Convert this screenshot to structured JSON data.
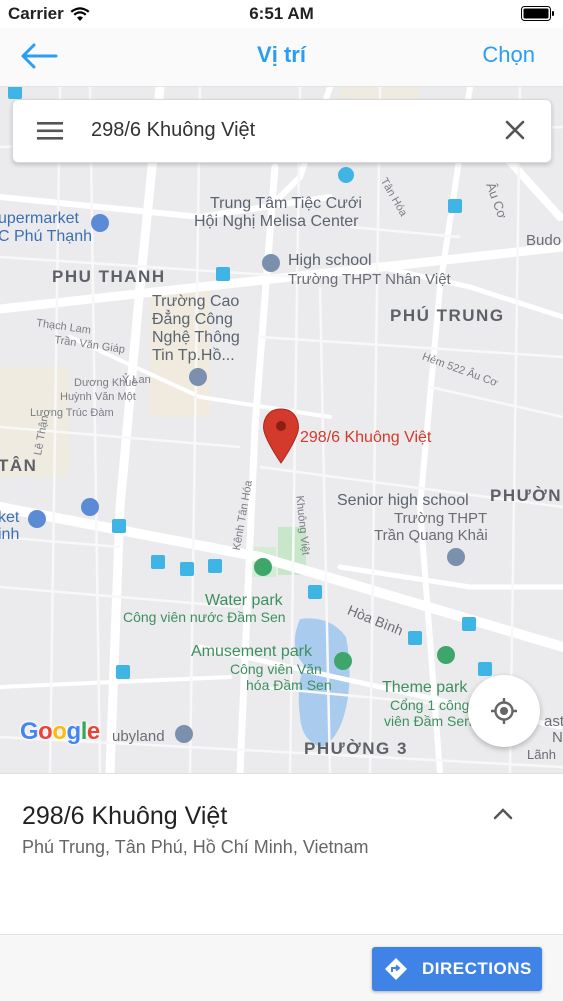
{
  "status_bar": {
    "carrier": "Carrier",
    "time": "6:51 AM"
  },
  "nav": {
    "title": "Vị trí",
    "action": "Chọn"
  },
  "search": {
    "query": "298/6 Khuông Việt"
  },
  "map": {
    "labels": {
      "supermarket": "upermarket",
      "phu_thanh_edge": "C Phú Thạnh",
      "melisa_1": "Trung Tâm Tiệc Cưới",
      "melisa_2": "Hội Nghị Melisa Center",
      "tan_hoa_street": "Tân Hóa",
      "au_co_street": "Âu Cơ",
      "budo": "Budo",
      "phu_thanh": "PHU THANH",
      "high_school": "High school",
      "nhan_viet": "Trường THPT Nhân Việt",
      "cao_dang_1": "Trường Cao",
      "cao_dang_2": "Đẳng Công",
      "cao_dang_3": "Nghệ Thông",
      "cao_dang_4": "Tin Tp.Hồ...",
      "phu_trung": "PHÚ TRUNG",
      "thach_lam": "Thạch Lam",
      "tran_van_giap": "Trần Văn Giáp",
      "y_lan": "Ỷ Lan",
      "duong_khue": "Dương Khuê",
      "huynh_van_mot": "Huỳnh Văn Một",
      "luong_truc_dam": "Lương Trúc Đàm",
      "hem_522": "Hẻm 522 Âu Cơ",
      "pin_label": "298/6 Khuông Việt",
      "le_than": "Lê Thận",
      "tan_edge": "TÂN",
      "kenh_tan_hoa": "Kênh Tân Hóa",
      "khuong_viet": "Khuông Việt",
      "senior_high": "Senior high school",
      "thpt": "Trường THPT",
      "tran_quang_khai": "Trần Quang Khải",
      "phuong_edge": "PHƯỜN",
      "ket_edge": "ket",
      "inh_edge": "inh",
      "water_park": "Water park",
      "dam_sen_water": "Công viên nước Đầm Sen",
      "hoa_binh": "Hòa Bình",
      "amusement_park": "Amusement park",
      "cv_van_1": "Công viên Văn",
      "cv_van_2": "hóa Đầm Sen",
      "theme_park": "Theme park",
      "cong_1": "Cổng 1 công",
      "cong_2": "viên Đầm Sen",
      "ubyland": "ubyland",
      "phuong_3": "PHƯỜNG 3",
      "asti_edge": "asti",
      "n_edge": "N",
      "lanh_edge": "Lãnh"
    }
  },
  "google_logo": {
    "g": "G",
    "o1": "o",
    "o2": "o",
    "g2": "g",
    "l": "l",
    "e": "e"
  },
  "place": {
    "name": "298/6 Khuông Việt",
    "address": "Phú Trung, Tân Phú, Hồ Chí Minh, Vietnam"
  },
  "footer": {
    "directions_label": "DIRECTIONS"
  },
  "colors": {
    "accent": "#2a9df4",
    "pin": "#d33a2c",
    "button": "#3f83e6"
  }
}
